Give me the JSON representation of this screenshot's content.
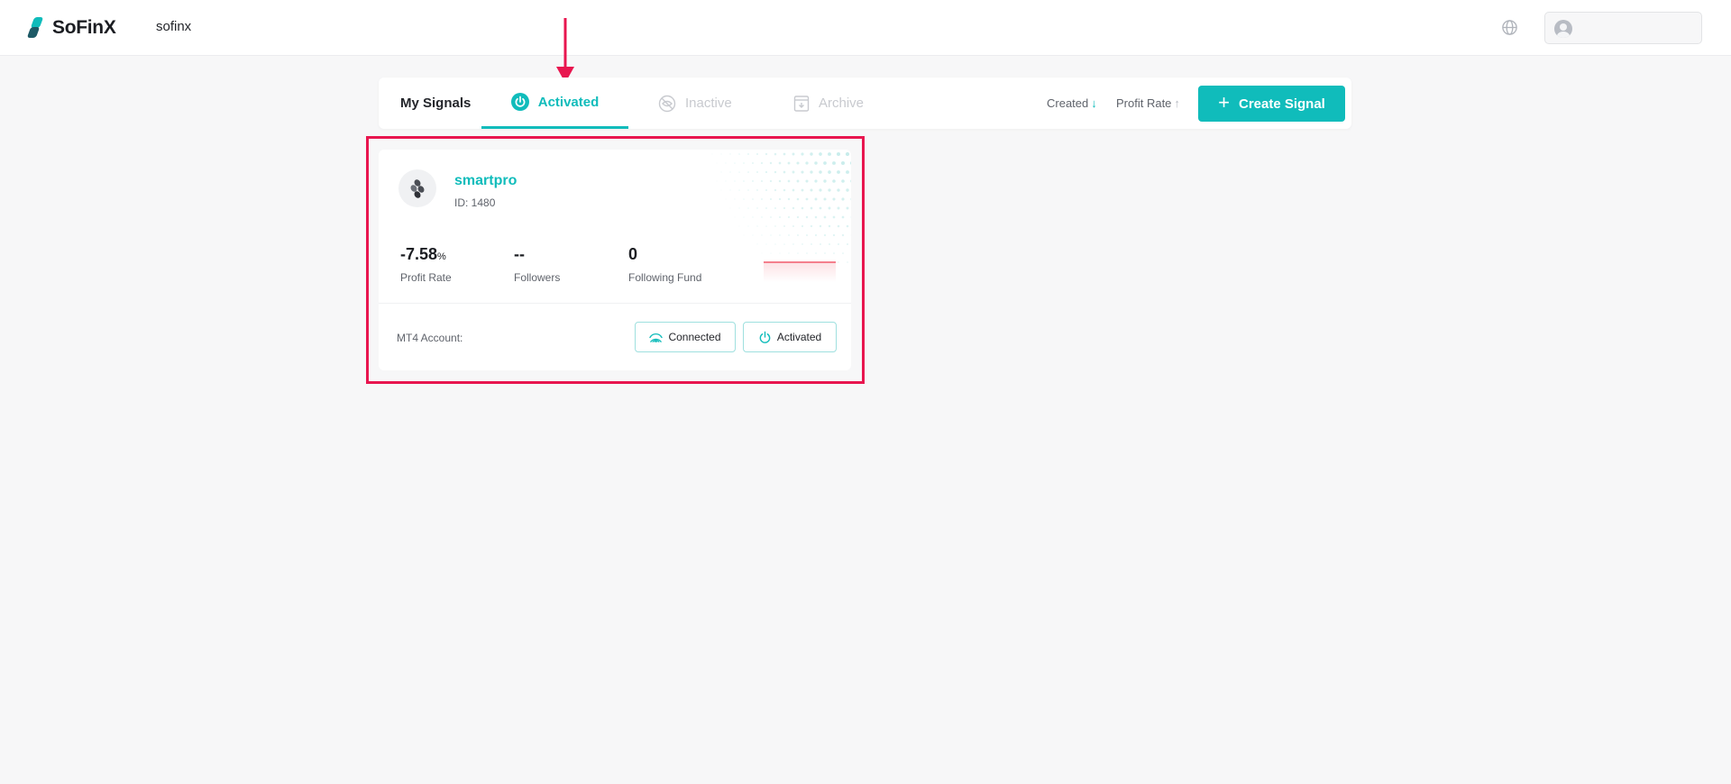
{
  "header": {
    "logo_text": "SoFinX",
    "brand_sub": "sofinx",
    "globe_icon": "globe-icon",
    "user_icon": "user-avatar-icon"
  },
  "tabs": {
    "title": "My Signals",
    "items": [
      {
        "label": "Activated",
        "icon": "power-icon",
        "active": true
      },
      {
        "label": "Inactive",
        "icon": "eye-off-icon",
        "active": false
      },
      {
        "label": "Archive",
        "icon": "archive-icon",
        "active": false
      }
    ]
  },
  "sort": {
    "created_label": "Created",
    "created_arrow": "↓",
    "profit_label": "Profit Rate",
    "profit_arrow": "↑"
  },
  "create_button": {
    "label": "Create Signal",
    "plus": "+"
  },
  "signal_card": {
    "name": "smartpro",
    "id_text": "ID: 1480",
    "profit_rate": "-7.58",
    "profit_unit": "%",
    "profit_label": "Profit Rate",
    "followers": "--",
    "followers_label": "Followers",
    "following_fund": "0",
    "following_fund_label": "Following Fund",
    "mt4_label": "MT4 Account:",
    "connected_label": "Connected",
    "activated_label": "Activated"
  },
  "colors": {
    "accent": "#10bcbb",
    "annotation": "#e8164f",
    "negative": "#f15b6c"
  }
}
